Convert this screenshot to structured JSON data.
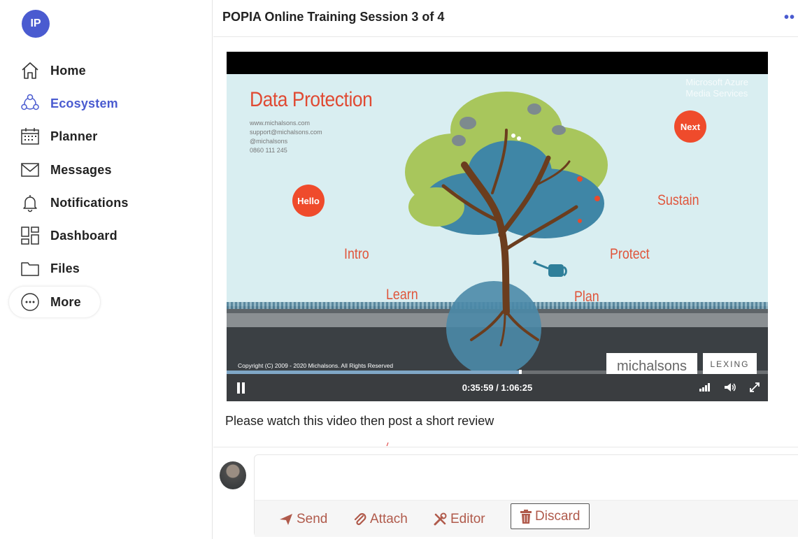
{
  "user": {
    "initials": "IP"
  },
  "sidebar": {
    "items": [
      {
        "label": "Home",
        "icon": "home-icon"
      },
      {
        "label": "Ecosystem",
        "icon": "ecosystem-icon",
        "active": true
      },
      {
        "label": "Planner",
        "icon": "calendar-icon"
      },
      {
        "label": "Messages",
        "icon": "mail-icon"
      },
      {
        "label": "Notifications",
        "icon": "bell-icon"
      },
      {
        "label": "Dashboard",
        "icon": "dashboard-icon"
      },
      {
        "label": "Files",
        "icon": "folder-icon"
      },
      {
        "label": "More",
        "icon": "more-icon"
      }
    ]
  },
  "header": {
    "title": "POPIA Online Training Session 3 of 4"
  },
  "video": {
    "slide_title": "Data Protection",
    "contact": [
      "www.michalsons.com",
      "support@michalsons.com",
      "@michalsons",
      "0860 111 245"
    ],
    "bubbles": {
      "hello": "Hello",
      "next": "Next"
    },
    "words": {
      "intro": "Intro",
      "learn": "Learn",
      "protect": "Protect",
      "plan": "Plan",
      "sustain": "Sustain"
    },
    "watermark": [
      "Microsoft Azure",
      "Media Services"
    ],
    "copyright": "Copyright (C) 2009 - 2020 Michalsons. All Rights Reserved",
    "logo_michalsons": "michalsons",
    "logo_lexing": "LEXING",
    "time_display": "0:35:59 / 1:06:25",
    "progress_fraction": 0.542
  },
  "post": {
    "caption": "Please watch this video then post a short review"
  },
  "composer": {
    "send_label": "Send",
    "attach_label": "Attach",
    "editor_label": "Editor",
    "discard_label": "Discard"
  },
  "colors": {
    "accent": "#4a5bd0",
    "action": "#b05a4b",
    "slide_red": "#e04a33"
  }
}
